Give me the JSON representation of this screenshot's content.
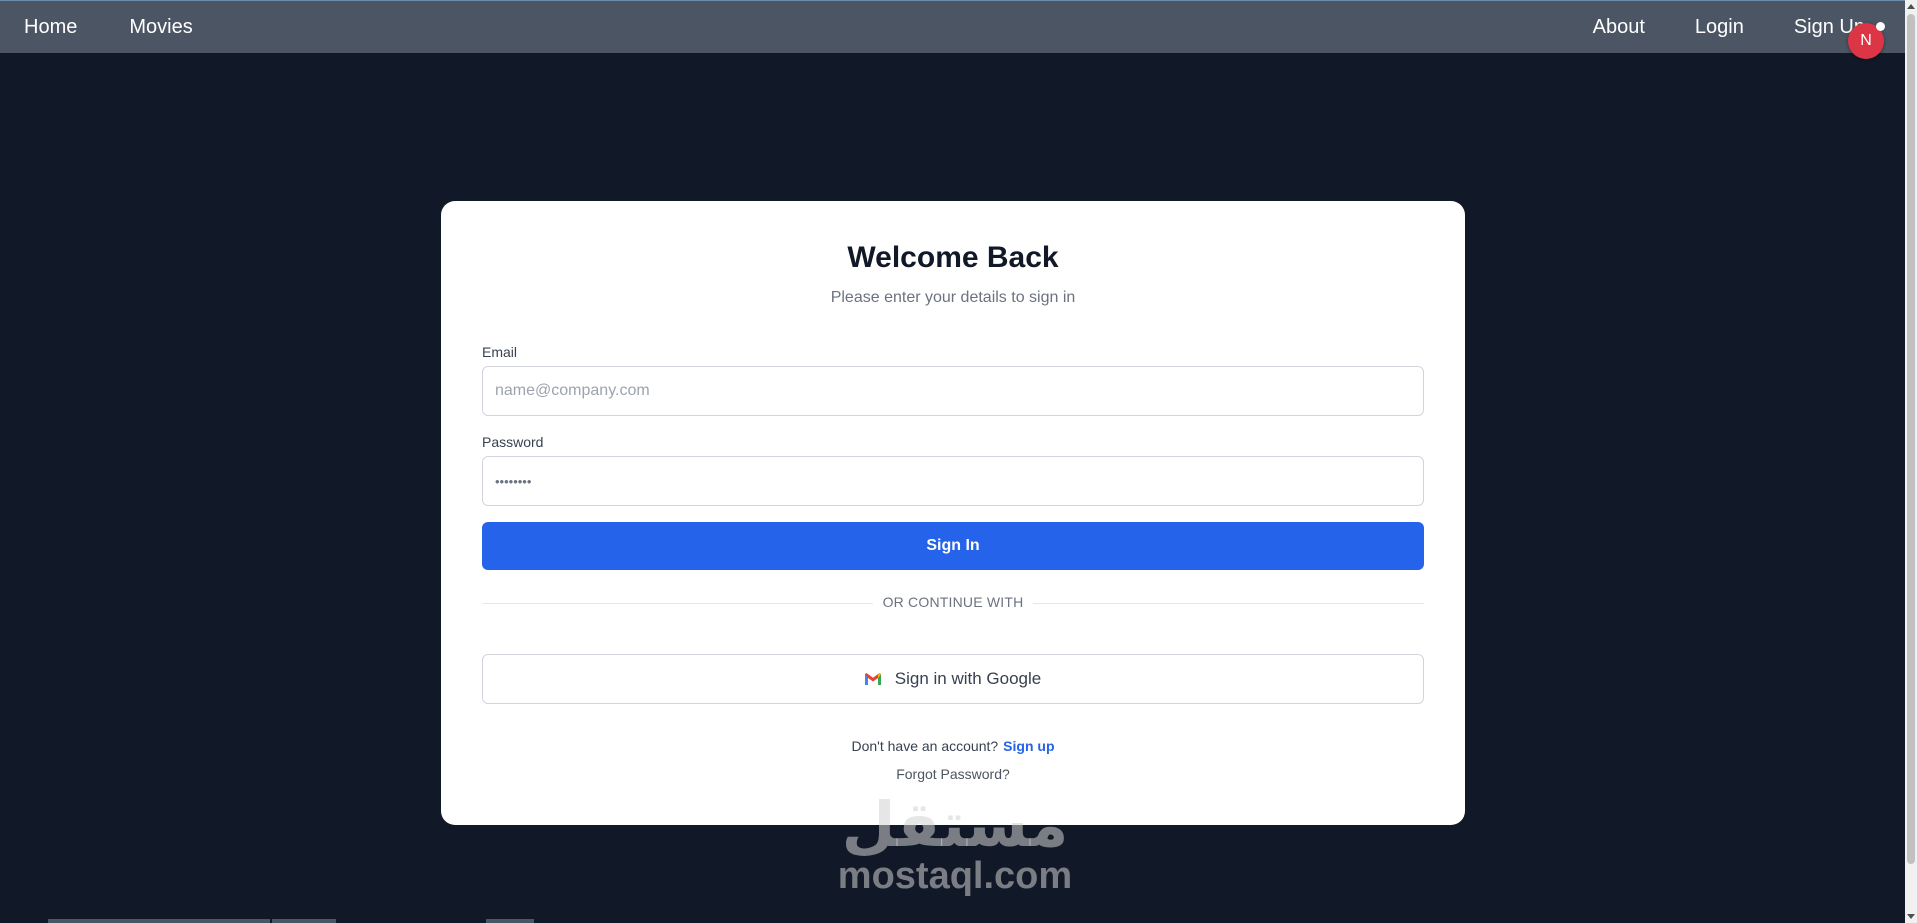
{
  "nav": {
    "left": [
      {
        "label": "Home"
      },
      {
        "label": "Movies"
      }
    ],
    "right": [
      {
        "label": "About"
      },
      {
        "label": "Login"
      },
      {
        "label": "Sign Up"
      }
    ],
    "avatar_initial": "N"
  },
  "card": {
    "title": "Welcome Back",
    "subtitle": "Please enter your details to sign in",
    "email_label": "Email",
    "email_placeholder": "name@company.com",
    "password_label": "Password",
    "password_value": "••••••••",
    "signin_label": "Sign In",
    "divider_text": "OR CONTINUE WITH",
    "google_label": "Sign in with Google",
    "no_account_text": "Don't have an account?",
    "signup_label": "Sign up",
    "forgot_label": "Forgot Password?"
  },
  "watermark": {
    "arabic": "مستقل",
    "latin": "mostaql.com"
  },
  "colors": {
    "background": "#111827",
    "navbar": "#4b5563",
    "primary": "#2563eb",
    "avatar": "#dc3545"
  }
}
